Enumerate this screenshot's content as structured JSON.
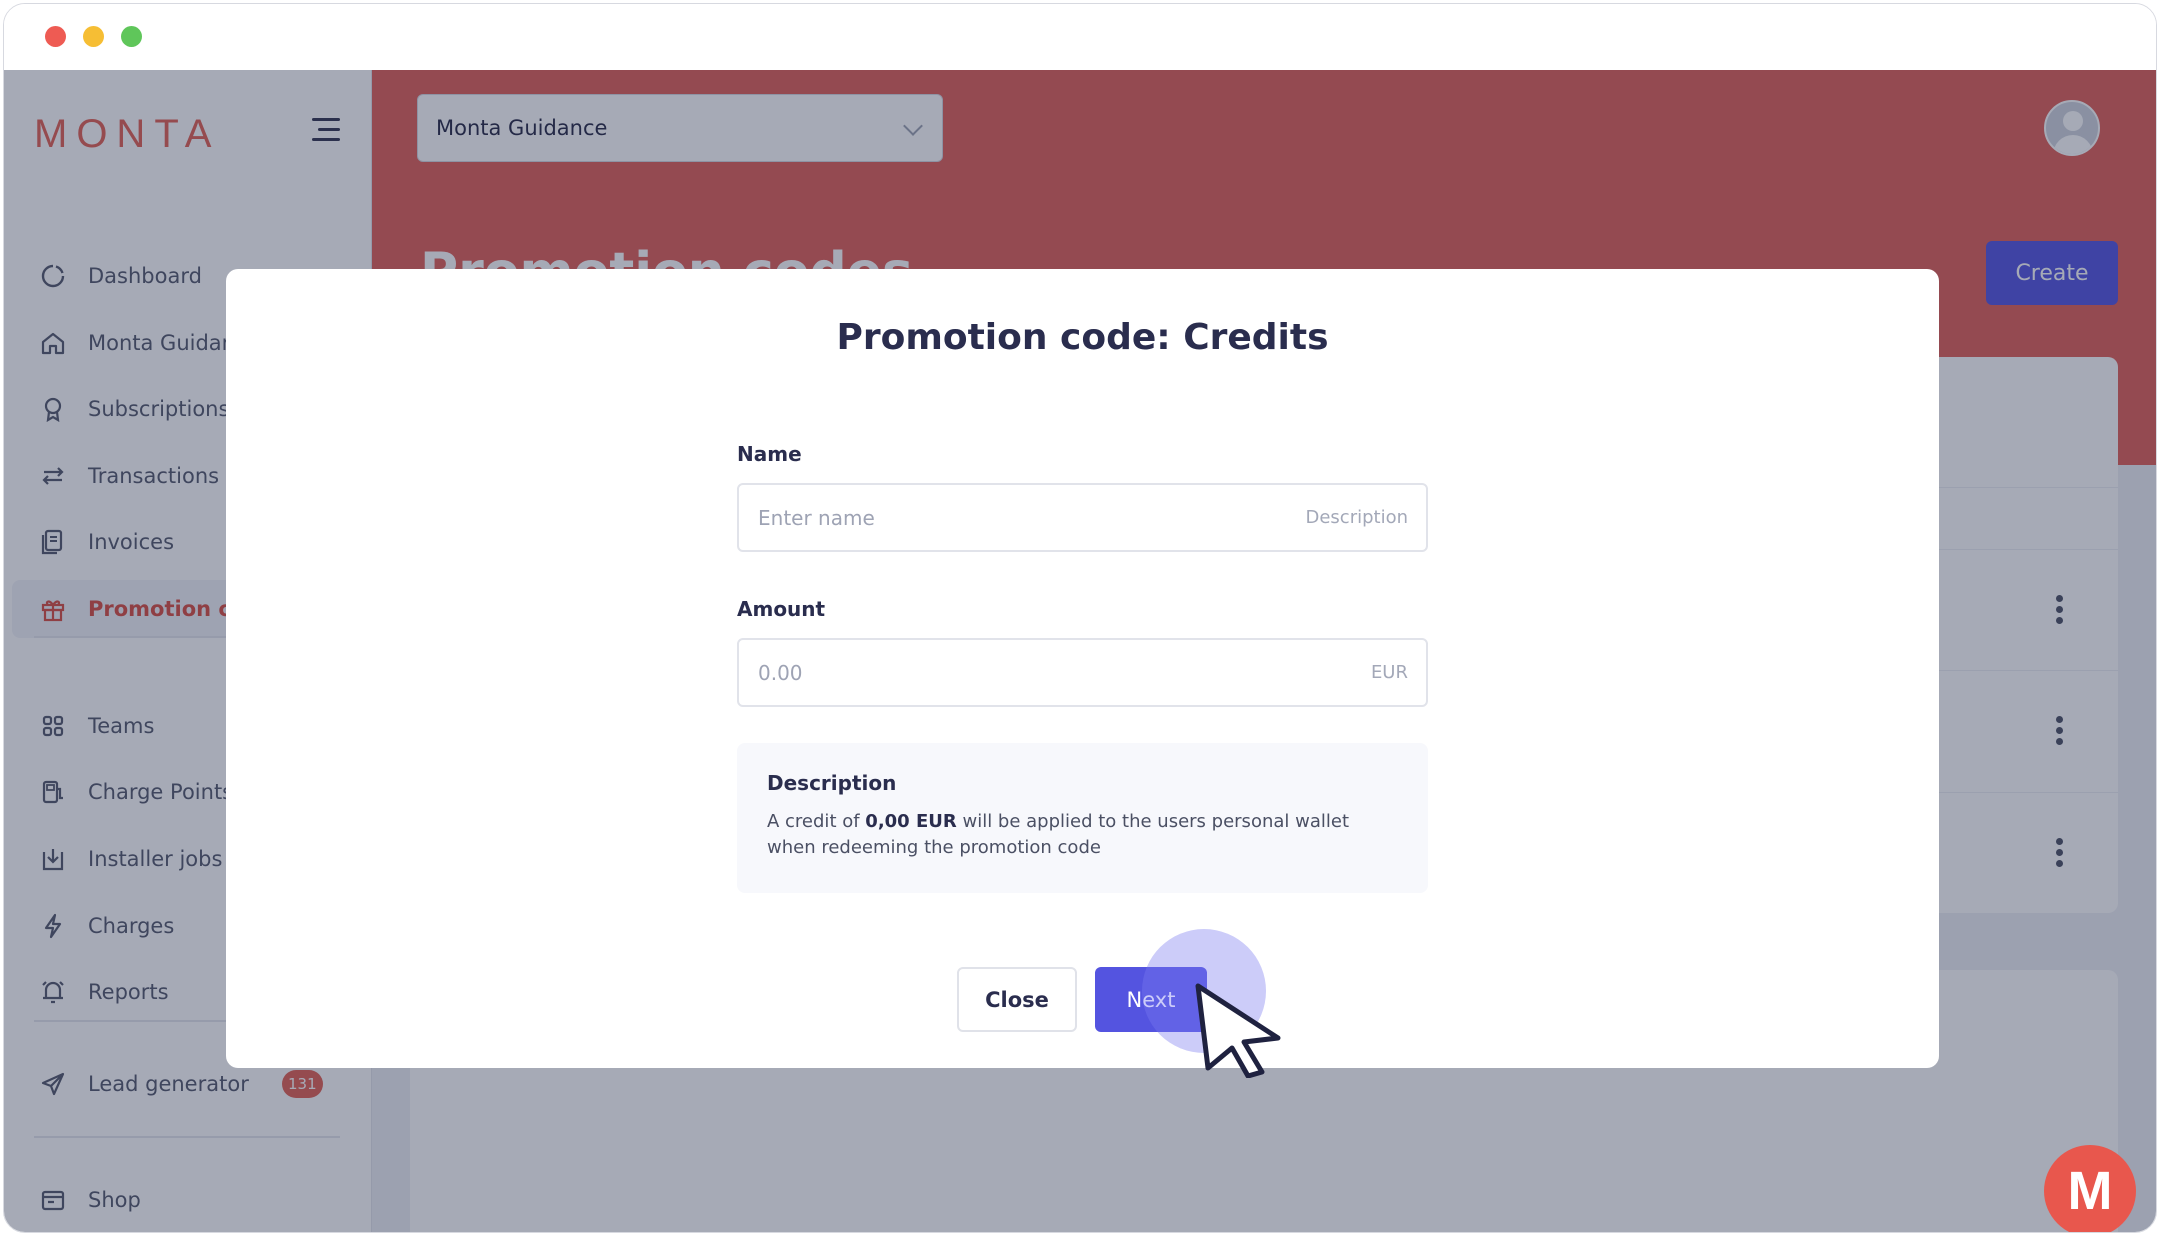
{
  "brand": {
    "logo": "MONTA",
    "accent": "#e25c4f",
    "primary": "#5454e0"
  },
  "header": {
    "account_selector": "Monta Guidance",
    "page_title": "Promotion codes",
    "create_label": "Create"
  },
  "sidebar": {
    "items": [
      {
        "label": "Dashboard",
        "icon": "dashboard-icon"
      },
      {
        "label": "Monta Guidance",
        "icon": "home-icon"
      },
      {
        "label": "Subscriptions",
        "icon": "badge-icon"
      },
      {
        "label": "Transactions",
        "icon": "transfer-icon"
      },
      {
        "label": "Invoices",
        "icon": "invoice-icon"
      },
      {
        "label": "Promotion codes",
        "icon": "gift-icon",
        "active": true
      },
      {
        "label": "Teams",
        "icon": "grid-icon"
      },
      {
        "label": "Charge Points",
        "icon": "charge-point-icon"
      },
      {
        "label": "Installer jobs",
        "icon": "download-icon"
      },
      {
        "label": "Charges",
        "icon": "lightning-icon"
      },
      {
        "label": "Reports",
        "icon": "bell-icon"
      },
      {
        "label": "Lead generator",
        "icon": "send-icon",
        "badge": "131"
      },
      {
        "label": "Shop",
        "icon": "shop-icon"
      }
    ]
  },
  "modal": {
    "title": "Promotion code: Credits",
    "name": {
      "label": "Name",
      "placeholder": "Enter name",
      "suffix": "Description"
    },
    "amount": {
      "label": "Amount",
      "placeholder": "0.00",
      "suffix": "EUR"
    },
    "description": {
      "title": "Description",
      "text_before": "A credit of ",
      "amount_bold": "0,00 EUR",
      "text_after": " will be applied to the users personal wallet when redeeming the promotion code"
    },
    "close_label": "Close",
    "next_label": "Next"
  },
  "fab": {
    "label": "M"
  }
}
